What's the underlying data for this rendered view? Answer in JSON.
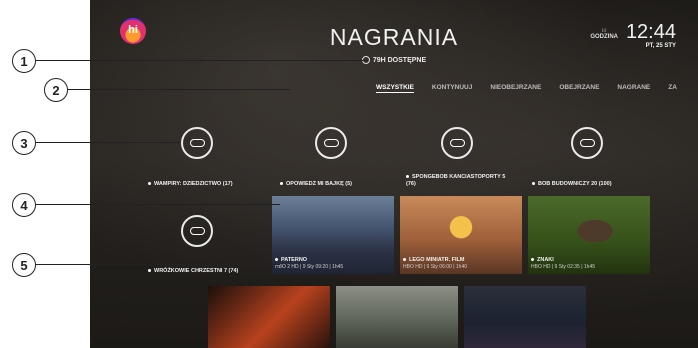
{
  "logo": {
    "text": "hi"
  },
  "header": {
    "title": "NAGRANIA",
    "available": "79H DOSTĘPNE",
    "hour_label": "GODZINA",
    "time": "12:44",
    "date": "PT, 25 STY"
  },
  "tabs": [
    {
      "label": "WSZYSTKIE",
      "active": true
    },
    {
      "label": "KONTYNUUJ"
    },
    {
      "label": "NIEOBEJRZANE"
    },
    {
      "label": "OBEJRZANE"
    },
    {
      "label": "NAGRANE"
    },
    {
      "label": "ZA"
    }
  ],
  "folders": [
    {
      "label": "WAMPIRY: DZIEDZICTWO (17)"
    },
    {
      "label": "OPOWIEDZ MI BAJKĘ (5)"
    },
    {
      "label": "SPONGEBOB KANCIASTOPORTY 5 (76)"
    },
    {
      "label": "BOB BUDOWNICZY 20 (100)"
    },
    {
      "label": "WRÓŻKOWIE CHRZESTNI 7 (74)"
    }
  ],
  "recordings": [
    {
      "title": "PATERNO",
      "meta": "HBO 2 HD | 9 Sty 09:20 | 1h45"
    },
    {
      "title": "LEGO MINIATR. FILM",
      "meta": "HBO HD | 9 Sty 06:00 | 1h40"
    },
    {
      "title": "ZNAKI",
      "meta": "HBO HD | 9 Sty 02:35 | 1h45"
    }
  ],
  "callouts": [
    "1",
    "2",
    "3",
    "4",
    "5"
  ],
  "colors": {
    "accent": "#ffffff",
    "callout_border": "#222222"
  }
}
